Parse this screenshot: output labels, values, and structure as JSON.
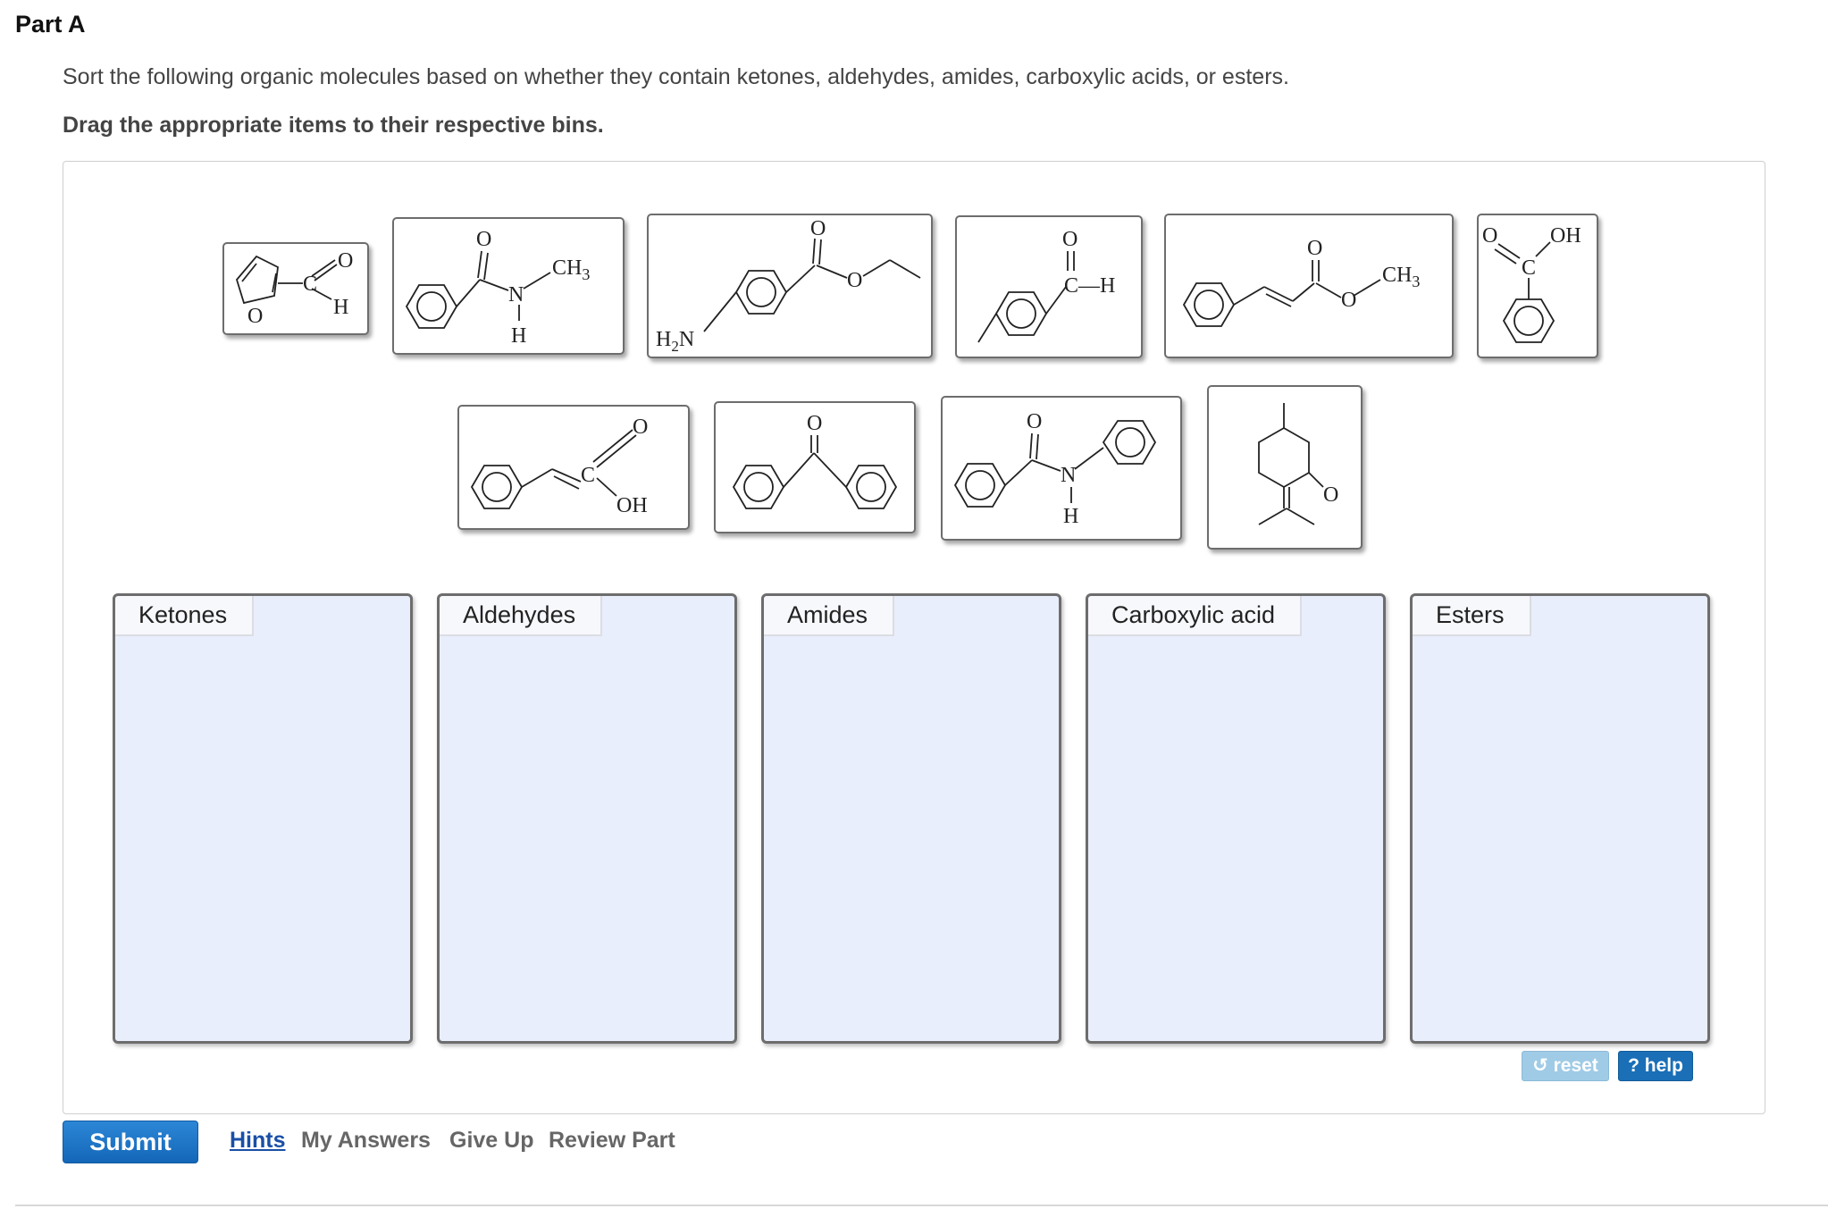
{
  "part": {
    "title": "Part A"
  },
  "question": {
    "instructions": "Sort the following organic molecules based on whether they contain ketones, aldehydes, amides, carboxylic acids, or esters.",
    "drag_instruction": "Drag the appropriate items to their respective bins."
  },
  "molecules": {
    "label_o": "O",
    "label_h": "H",
    "label_n": "N",
    "label_c": "C",
    "label_oh": "OH",
    "label_ch3": "CH",
    "label_sub3": "3",
    "label_h2n_h": "H",
    "label_h2n_2": "2",
    "label_h2n_n": "N",
    "label_c_h": "C—H"
  },
  "bins": [
    {
      "label": "Ketones"
    },
    {
      "label": "Aldehydes"
    },
    {
      "label": "Amides"
    },
    {
      "label": "Carboxylic acid"
    },
    {
      "label": "Esters"
    }
  ],
  "toolbar": {
    "reset_label": "↺ reset",
    "help_label": "? help"
  },
  "footer": {
    "submit_label": "Submit",
    "hints_label": "Hints",
    "my_answers_label": "My Answers",
    "give_up_label": "Give Up",
    "review_part_label": "Review Part"
  }
}
